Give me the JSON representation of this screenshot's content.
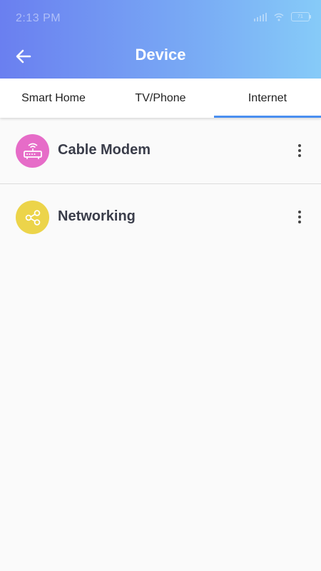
{
  "status_bar": {
    "time": "2:13 PM",
    "battery": "71"
  },
  "header": {
    "title": "Device",
    "back_icon": "arrow-left-icon"
  },
  "tabs": [
    {
      "label": "Smart Home",
      "active": false
    },
    {
      "label": "TV/Phone",
      "active": false
    },
    {
      "label": "Internet",
      "active": true
    }
  ],
  "devices": [
    {
      "label": "Cable Modem",
      "icon": "router-icon",
      "color": "#e66cc8"
    },
    {
      "label": "Networking",
      "icon": "share-icon",
      "color": "#ecd44a"
    }
  ],
  "colors": {
    "header_gradient_start": "#6a7ff0",
    "header_gradient_end": "#86cbf8",
    "tab_indicator": "#4a8ff0"
  }
}
